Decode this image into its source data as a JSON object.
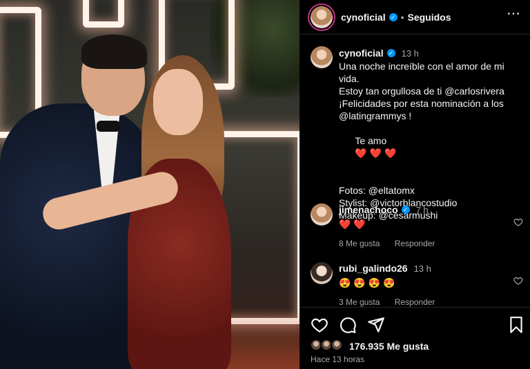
{
  "post": {
    "username": "cynoficial",
    "follow_status": "Seguidos",
    "caption": {
      "time": "13 h",
      "lines": [
        "Una noche increíble con el amor de mi",
        "vida.",
        "Estoy tan orgullosa de ti @carlosrivera",
        "¡Felicidades por esta nominación a los",
        "@latingrammys !",
        "Te amo"
      ],
      "hearts": "❤️ ❤️ ❤️",
      "credits": [
        "Fotos: @eltatomx",
        "Stylist: @victorblancostudio",
        "Makeup: @cesarmushi"
      ]
    },
    "comments": [
      {
        "username": "jimenachoco",
        "time": "7 h",
        "text": "❤️ ❤️",
        "likes": "8 Me gusta",
        "reply": "Responder"
      },
      {
        "username": "rubi_galindo26",
        "time": "13 h",
        "text": "😍 😍 😍 😍",
        "likes": "3 Me gusta",
        "reply": "Responder"
      }
    ],
    "likes_count": "176.935 Me gusta",
    "posted_ago": "Hace 13 horas"
  },
  "icons": {
    "more": "more-options-icon",
    "like": "heart-icon",
    "comment": "comment-icon",
    "share": "share-icon",
    "save": "bookmark-icon",
    "verified": "verified-badge-icon"
  },
  "colors": {
    "background": "#000000",
    "text": "#f5f5f5",
    "muted": "#a8a8a8",
    "verified": "#0095f6",
    "divider": "#262626"
  }
}
